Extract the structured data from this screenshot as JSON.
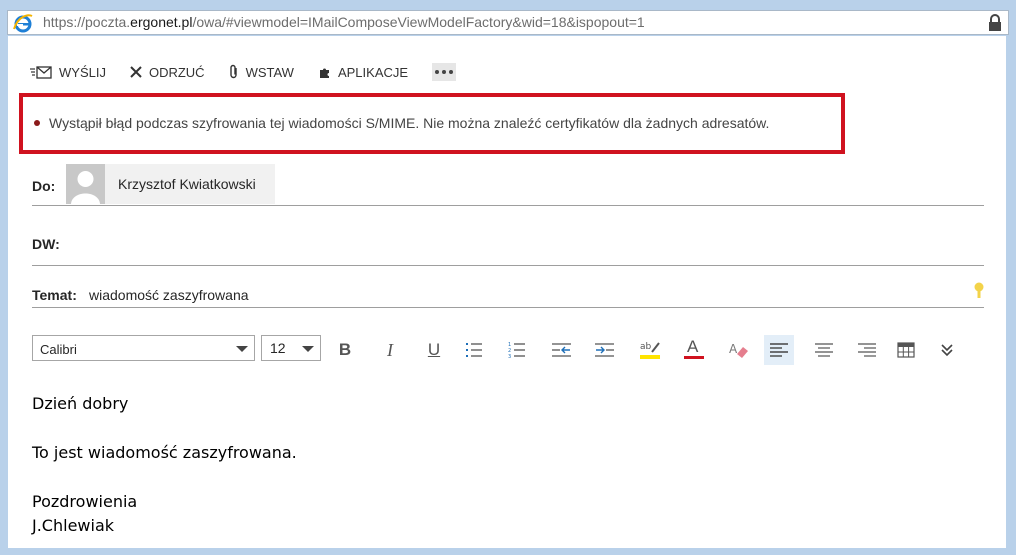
{
  "browser": {
    "url_prefix": "https://poczta.",
    "url_domain": "ergonet.pl",
    "url_path": "/owa/#viewmodel=IMailComposeViewModelFactory&wid=18&ispopout=1"
  },
  "toolbar": {
    "send": "WYŚLIJ",
    "discard": "ODRZUĆ",
    "insert": "WSTAW",
    "apps": "APLIKACJE"
  },
  "error": {
    "message": "Wystąpił błąd podczas szyfrowania tej wiadomości S/MIME. Nie można znaleźć certyfikatów dla żadnych adresatów."
  },
  "fields": {
    "to_label": "Do:",
    "to_recipient": "Krzysztof Kwiatkowski",
    "cc_label": "DW:",
    "subject_label": "Temat:",
    "subject_value": "wiadomość zaszyfrowana"
  },
  "format": {
    "font": "Calibri",
    "size": "12",
    "bold": "B",
    "italic": "I",
    "underline": "U",
    "font_color": "A"
  },
  "body": {
    "line1": "Dzień dobry",
    "line2": "To jest wiadomość zaszyfrowana.",
    "line3": "Pozdrowienia",
    "line4": "J.Chlewiak"
  },
  "colors": {
    "error_border": "#d0121f",
    "highlight": "#ffe400",
    "font_color": "#d0121f"
  }
}
